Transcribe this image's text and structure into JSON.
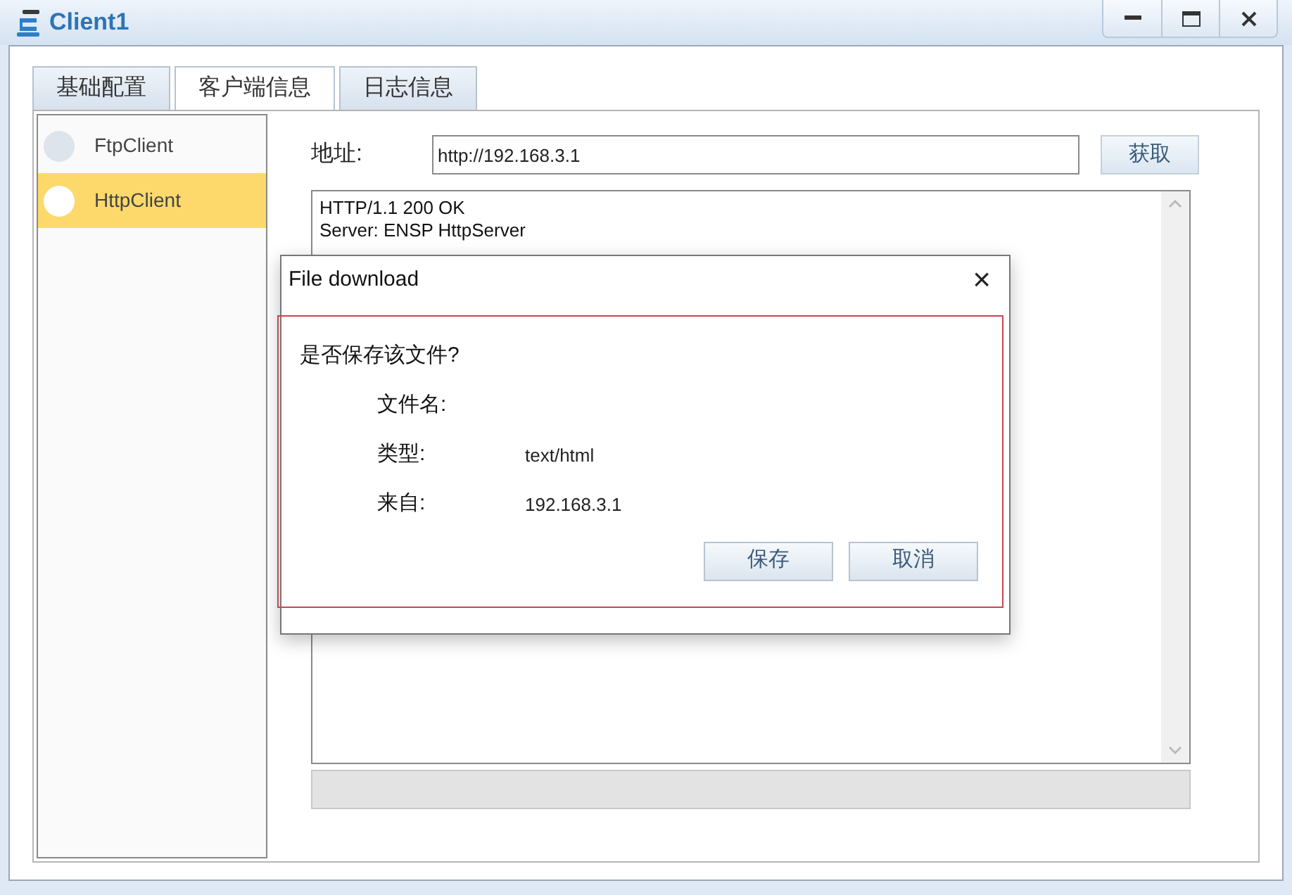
{
  "window": {
    "title": "Client1"
  },
  "tabs": [
    {
      "label": "基础配置",
      "selected": false
    },
    {
      "label": "客户端信息",
      "selected": true
    },
    {
      "label": "日志信息",
      "selected": false
    }
  ],
  "clients": [
    {
      "label": "FtpClient",
      "selected": false
    },
    {
      "label": "HttpClient",
      "selected": true
    }
  ],
  "address": {
    "label": "地址:",
    "value": "http://192.168.3.1",
    "button": "获取"
  },
  "response_lines": [
    "HTTP/1.1 200 OK",
    "Server: ENSP HttpServer"
  ],
  "dialog": {
    "title": "File download",
    "close": "×",
    "question": "是否保存该文件?",
    "fields": [
      {
        "label": "文件名:"
      },
      {
        "label": "类型:",
        "value": "text/html"
      },
      {
        "label": "来自:",
        "value": "192.168.3.1"
      }
    ],
    "buttons": [
      "保存",
      "取消"
    ]
  }
}
